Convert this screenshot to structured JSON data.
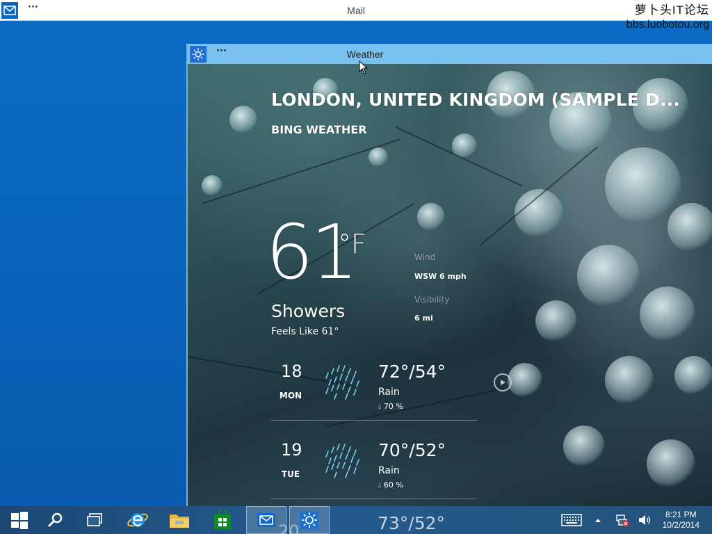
{
  "mail_window": {
    "title": "Mail",
    "menu_label": "···",
    "icon": "mail-icon"
  },
  "watermark": {
    "line1": "萝卜头IT论坛",
    "line2": "bbs.luobotou.org"
  },
  "weather_window": {
    "title": "Weather",
    "menu_label": "···",
    "icon": "sun-icon"
  },
  "weather": {
    "location": "LONDON, UNITED KINGDOM (SAMPLE D...",
    "provider": "BING WEATHER",
    "temperature": "61",
    "unit": "°F",
    "condition": "Showers",
    "feels_like": "Feels Like 61°",
    "wind_label": "Wind",
    "wind_value": "WSW 6 mph",
    "visibility_label": "Visibility",
    "visibility_value": "6 mi",
    "forecast": [
      {
        "day": "18",
        "dow": "MON",
        "temps": "72°/54°",
        "condition": "Rain",
        "precip": "70 %",
        "icon": "rain-icon"
      },
      {
        "day": "19",
        "dow": "TUE",
        "temps": "70°/52°",
        "condition": "Rain",
        "precip": "60 %",
        "icon": "rain-icon"
      }
    ],
    "peek_day": "20",
    "peek_temps": "73°/52°"
  },
  "taskbar": {
    "items": [
      "start-icon",
      "search-icon",
      "task-view-icon",
      "internet-explorer-icon",
      "file-explorer-icon",
      "store-icon",
      "mail-icon",
      "weather-icon"
    ],
    "tray": [
      "touch-keyboard-icon",
      "show-hidden-icons-icon",
      "network-disconnected-icon",
      "volume-icon"
    ],
    "time": "8:21 PM",
    "date": "10/2/2014"
  },
  "colors": {
    "desktop_blue": "#0a5fb4",
    "weather_titlebar": "#78c0ee",
    "rain_icon": "#6fd6ef",
    "store_green": "#0f8a26",
    "ie_blue": "#1f8fe0",
    "explorer_yellow": "#e8b441"
  }
}
